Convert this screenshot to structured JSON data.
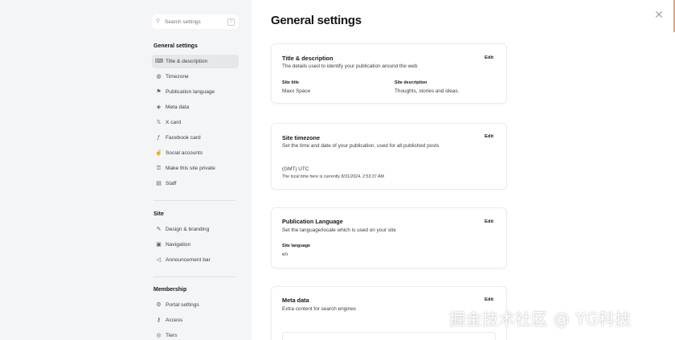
{
  "search": {
    "placeholder": "Search settings",
    "shortcut": "/"
  },
  "sidebar": {
    "general": {
      "title": "General settings",
      "items": [
        {
          "label": "Title & description",
          "icon": "title-icon",
          "glyph": "⌨",
          "active": true
        },
        {
          "label": "Timezone",
          "icon": "globe-icon",
          "glyph": "◍"
        },
        {
          "label": "Publication language",
          "icon": "language-icon",
          "glyph": "⚑"
        },
        {
          "label": "Meta data",
          "icon": "layers-icon",
          "glyph": "◈"
        },
        {
          "label": "X card",
          "icon": "x-logo-icon",
          "glyph": "𝕏"
        },
        {
          "label": "Facebook card",
          "icon": "facebook-icon",
          "glyph": "ƒ"
        },
        {
          "label": "Social accounts",
          "icon": "thumbs-up-icon",
          "glyph": "☝"
        },
        {
          "label": "Make this site private",
          "icon": "lock-icon",
          "glyph": "⚿"
        },
        {
          "label": "Staff",
          "icon": "staff-icon",
          "glyph": "▤"
        }
      ]
    },
    "site": {
      "title": "Site",
      "items": [
        {
          "label": "Design & branding",
          "icon": "brush-icon",
          "glyph": "✎"
        },
        {
          "label": "Navigation",
          "icon": "navigation-icon",
          "glyph": "▣"
        },
        {
          "label": "Announcement bar",
          "icon": "megaphone-icon",
          "glyph": "◁"
        }
      ]
    },
    "membership": {
      "title": "Membership",
      "items": [
        {
          "label": "Portal settings",
          "icon": "portal-icon",
          "glyph": "⚙"
        },
        {
          "label": "Access",
          "icon": "key-icon",
          "glyph": "⚷"
        },
        {
          "label": "Tiers",
          "icon": "tiers-icon",
          "glyph": "◎"
        }
      ]
    }
  },
  "main": {
    "title": "General settings",
    "cards": {
      "title_desc": {
        "title": "Title & description",
        "desc": "The details used to identify your publication around the web",
        "edit": "Edit",
        "site_title_label": "Site title",
        "site_title_value": "Maxx Space",
        "site_desc_label": "Site description",
        "site_desc_value": "Thoughts, stories and ideas."
      },
      "timezone": {
        "title": "Site timezone",
        "desc": "Set the time and date of your publication, used for all published posts",
        "edit": "Edit",
        "value": "(GMT) UTC",
        "local_time": "The local time here is currently 8/31/2024, 2:53:37 AM"
      },
      "language": {
        "title": "Publication Language",
        "desc": "Set the language/locale which is used on your site",
        "edit": "Edit",
        "label": "Site language",
        "value": "en"
      },
      "meta": {
        "title": "Meta data",
        "desc": "Extra content for search engines",
        "edit": "Edit"
      }
    }
  },
  "watermark": "掘金技术社区 @ YG科技",
  "colors": {
    "sidebar_bg": "#f4f5f6",
    "active_item_bg": "#e5e8eb",
    "scroll_accent": "#e8a276"
  }
}
